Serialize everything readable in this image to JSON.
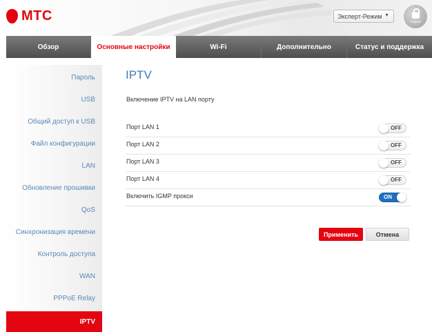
{
  "header": {
    "logo_text": "МТС",
    "mode_select": "Эксперт-Режим",
    "logout_label": "Logout"
  },
  "tabs": [
    {
      "label": "Обзор",
      "active": false
    },
    {
      "label": "Основные настройки",
      "active": true
    },
    {
      "label": "Wi-Fi",
      "active": false
    },
    {
      "label": "Дополнительно",
      "active": false
    },
    {
      "label": "Статус и поддержка",
      "active": false
    }
  ],
  "sidebar": {
    "items": [
      {
        "label": "Пароль"
      },
      {
        "label": "USB"
      },
      {
        "label": "Общий доступ к USB"
      },
      {
        "label": "Файл конфигурации"
      },
      {
        "label": "LAN"
      },
      {
        "label": "Обновление прошивки"
      },
      {
        "label": "QoS"
      },
      {
        "label": "Синхронизация времени"
      },
      {
        "label": "Контроль доступа"
      },
      {
        "label": "WAN"
      },
      {
        "label": "PPPoE Relay"
      },
      {
        "label": "IPTV"
      }
    ],
    "active_index": 11
  },
  "main": {
    "title": "IPTV",
    "subtitle": "Включение IPTV на LAN порту",
    "settings": [
      {
        "label": "Порт LAN 1",
        "state": "OFF"
      },
      {
        "label": "Порт LAN 2",
        "state": "OFF"
      },
      {
        "label": "Порт LAN 3",
        "state": "OFF"
      },
      {
        "label": "Порт LAN 4",
        "state": "OFF"
      },
      {
        "label": "Включить IGMP прокси",
        "state": "ON"
      }
    ],
    "apply_label": "Применить",
    "cancel_label": "Отмена"
  },
  "colors": {
    "brand_red": "#e30611",
    "link_blue": "#5a87b8",
    "toggle_on": "#1f6fbd",
    "title_blue": "#3b7bbf"
  }
}
